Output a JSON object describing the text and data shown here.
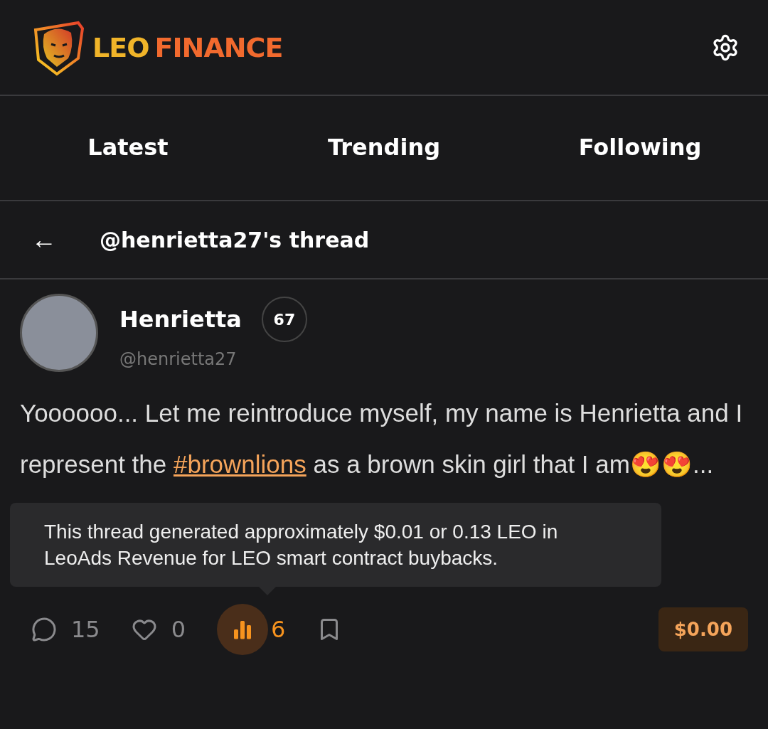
{
  "header": {
    "logo_left": "LEO",
    "logo_right": "FINANCE"
  },
  "tabs": [
    {
      "label": "Latest",
      "selected": false
    },
    {
      "label": "Trending",
      "selected": false
    },
    {
      "label": "Following",
      "selected": false
    }
  ],
  "thread_bar": {
    "back": "←",
    "title": "@henrietta27's thread"
  },
  "post": {
    "author": "Henrietta",
    "reputation": "67",
    "handle": "@henrietta27",
    "body_before": "Yoooooo... Let me reintroduce myself, my name is Henrietta and I represent the ",
    "hashtag": "#brownlions",
    "body_after": " as a brown skin girl that I am😍😍...",
    "tooltip": "This thread generated approximately $0.01 or 0.13 LEO in LeoAds Revenue for LEO smart contract buybacks.",
    "actions": [
      {
        "kind": "comment",
        "count": "15",
        "active": false
      },
      {
        "kind": "like",
        "count": "0",
        "active": false
      },
      {
        "kind": "views",
        "count": "6",
        "active": true
      },
      {
        "kind": "bookmark",
        "active": false
      }
    ],
    "payout": "$0.00"
  }
}
